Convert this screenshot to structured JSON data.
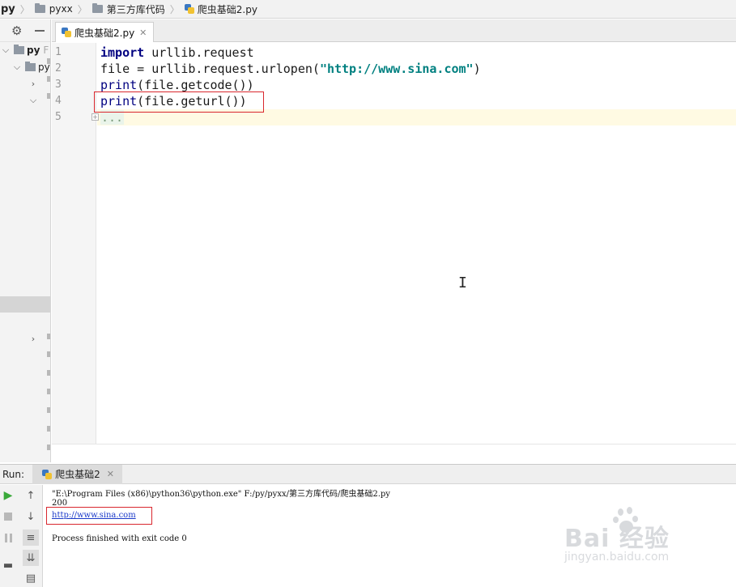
{
  "breadcrumb": {
    "items": [
      "py",
      "pyxx",
      "第三方库代码",
      "爬虫基础2.py"
    ]
  },
  "sidebar": {
    "root_label": "py",
    "root_suffix": "F",
    "child_label": "py"
  },
  "editor": {
    "tab_label": "爬虫基础2.py",
    "line_numbers": [
      "1",
      "2",
      "3",
      "4",
      "5"
    ],
    "lines": [
      {
        "kw": "import",
        "rest": " urllib.request"
      },
      {
        "pre": "file = urllib.request.urlopen(",
        "str": "\"http://www.sina.com\"",
        "post": ")"
      },
      {
        "fn": "print",
        "rest": "(file.getcode())"
      },
      {
        "fn": "print",
        "rest": "(file.geturl())"
      },
      {
        "ellipsis": "..."
      }
    ]
  },
  "run": {
    "label": "Run:",
    "tab_label": "爬虫基础2",
    "output": {
      "command": "\"E:\\Program Files (x86)\\python36\\python.exe\" F:/py/pyxx/第三方库代码/爬虫基础2.py",
      "code": "200",
      "url": "http://www.sina.com",
      "exit": "Process finished with exit code 0"
    }
  },
  "watermark": {
    "main": "Bai  经验",
    "sub": "jingyan.baidu.com"
  },
  "colors": {
    "highlight_box": "#d9272e",
    "keyword": "#000080",
    "string": "#008080",
    "link": "#1a39c9"
  }
}
